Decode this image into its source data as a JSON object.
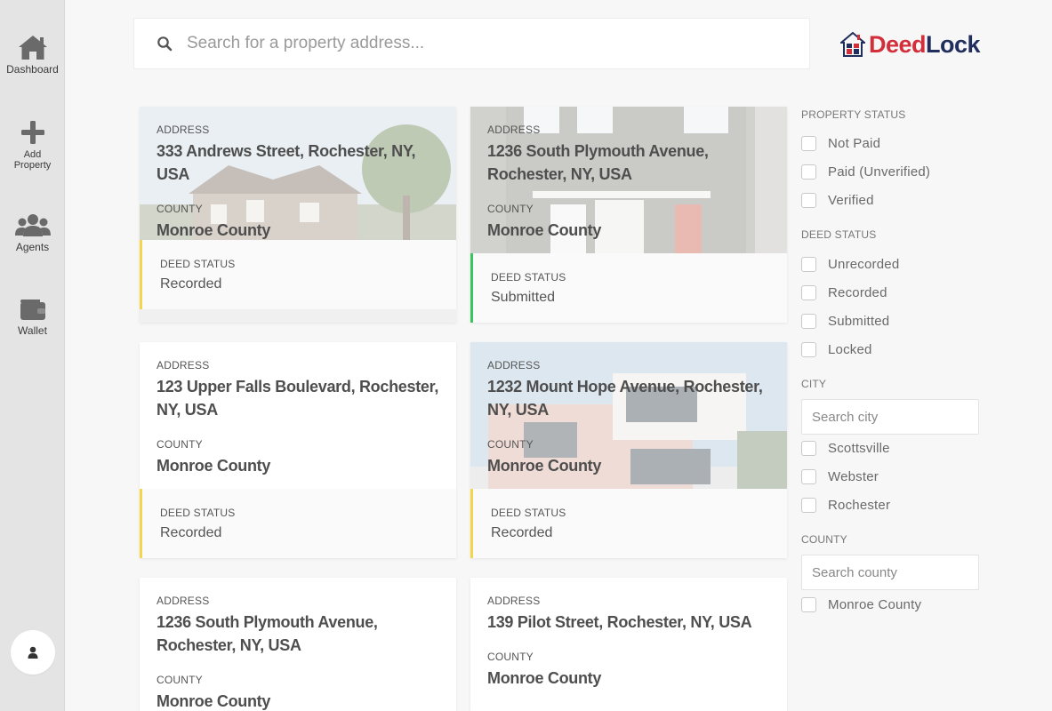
{
  "nav": {
    "items": [
      {
        "label": "Dashboard",
        "icon": "home-icon"
      },
      {
        "label": "Add Property",
        "icon": "plus-icon"
      },
      {
        "label": "Agents",
        "icon": "users-icon"
      },
      {
        "label": "Wallet",
        "icon": "wallet-icon"
      }
    ],
    "profile_icon": "user-icon"
  },
  "search": {
    "placeholder": "Search for a property address...",
    "value": ""
  },
  "brand": {
    "name_part1": "Deed",
    "name_part2": "Lock",
    "colors": {
      "deed": "#d32f3a",
      "lock": "#1f2e5c"
    }
  },
  "properties": [
    {
      "address_label": "ADDRESS",
      "address": "333 Andrews Street, Rochester, NY, USA",
      "county_label": "COUNTY",
      "county": "Monroe County",
      "deed_label": "DEED STATUS",
      "deed_status": "Recorded",
      "status_color": "#f5d54c"
    },
    {
      "address_label": "ADDRESS",
      "address": "1236 South Plymouth Avenue, Rochester, NY, USA",
      "county_label": "COUNTY",
      "county": "Monroe County",
      "deed_label": "DEED STATUS",
      "deed_status": "Submitted",
      "status_color": "#3cc45a"
    },
    {
      "address_label": "ADDRESS",
      "address": "123 Upper Falls Boulevard, Rochester, NY, USA",
      "county_label": "COUNTY",
      "county": "Monroe County",
      "deed_label": "DEED STATUS",
      "deed_status": "Recorded",
      "status_color": "#f5d54c"
    },
    {
      "address_label": "ADDRESS",
      "address": "1232 Mount Hope Avenue, Rochester, NY, USA",
      "county_label": "COUNTY",
      "county": "Monroe County",
      "deed_label": "DEED STATUS",
      "deed_status": "Recorded",
      "status_color": "#f5d54c"
    },
    {
      "address_label": "ADDRESS",
      "address": "1236 South Plymouth Avenue, Rochester, NY, USA",
      "county_label": "COUNTY",
      "county": "Monroe County"
    },
    {
      "address_label": "ADDRESS",
      "address": "139 Pilot Street, Rochester, NY, USA",
      "county_label": "COUNTY",
      "county": "Monroe County"
    }
  ],
  "filters": {
    "property_status": {
      "heading": "PROPERTY STATUS",
      "options": [
        "Not Paid",
        "Paid (Unverified)",
        "Verified"
      ]
    },
    "deed_status": {
      "heading": "DEED STATUS",
      "options": [
        "Unrecorded",
        "Recorded",
        "Submitted",
        "Locked"
      ]
    },
    "city": {
      "heading": "CITY",
      "placeholder": "Search city",
      "options": [
        "Scottsville",
        "Webster",
        "Rochester"
      ]
    },
    "county": {
      "heading": "COUNTY",
      "placeholder": "Search county",
      "options": [
        "Monroe County"
      ]
    }
  }
}
